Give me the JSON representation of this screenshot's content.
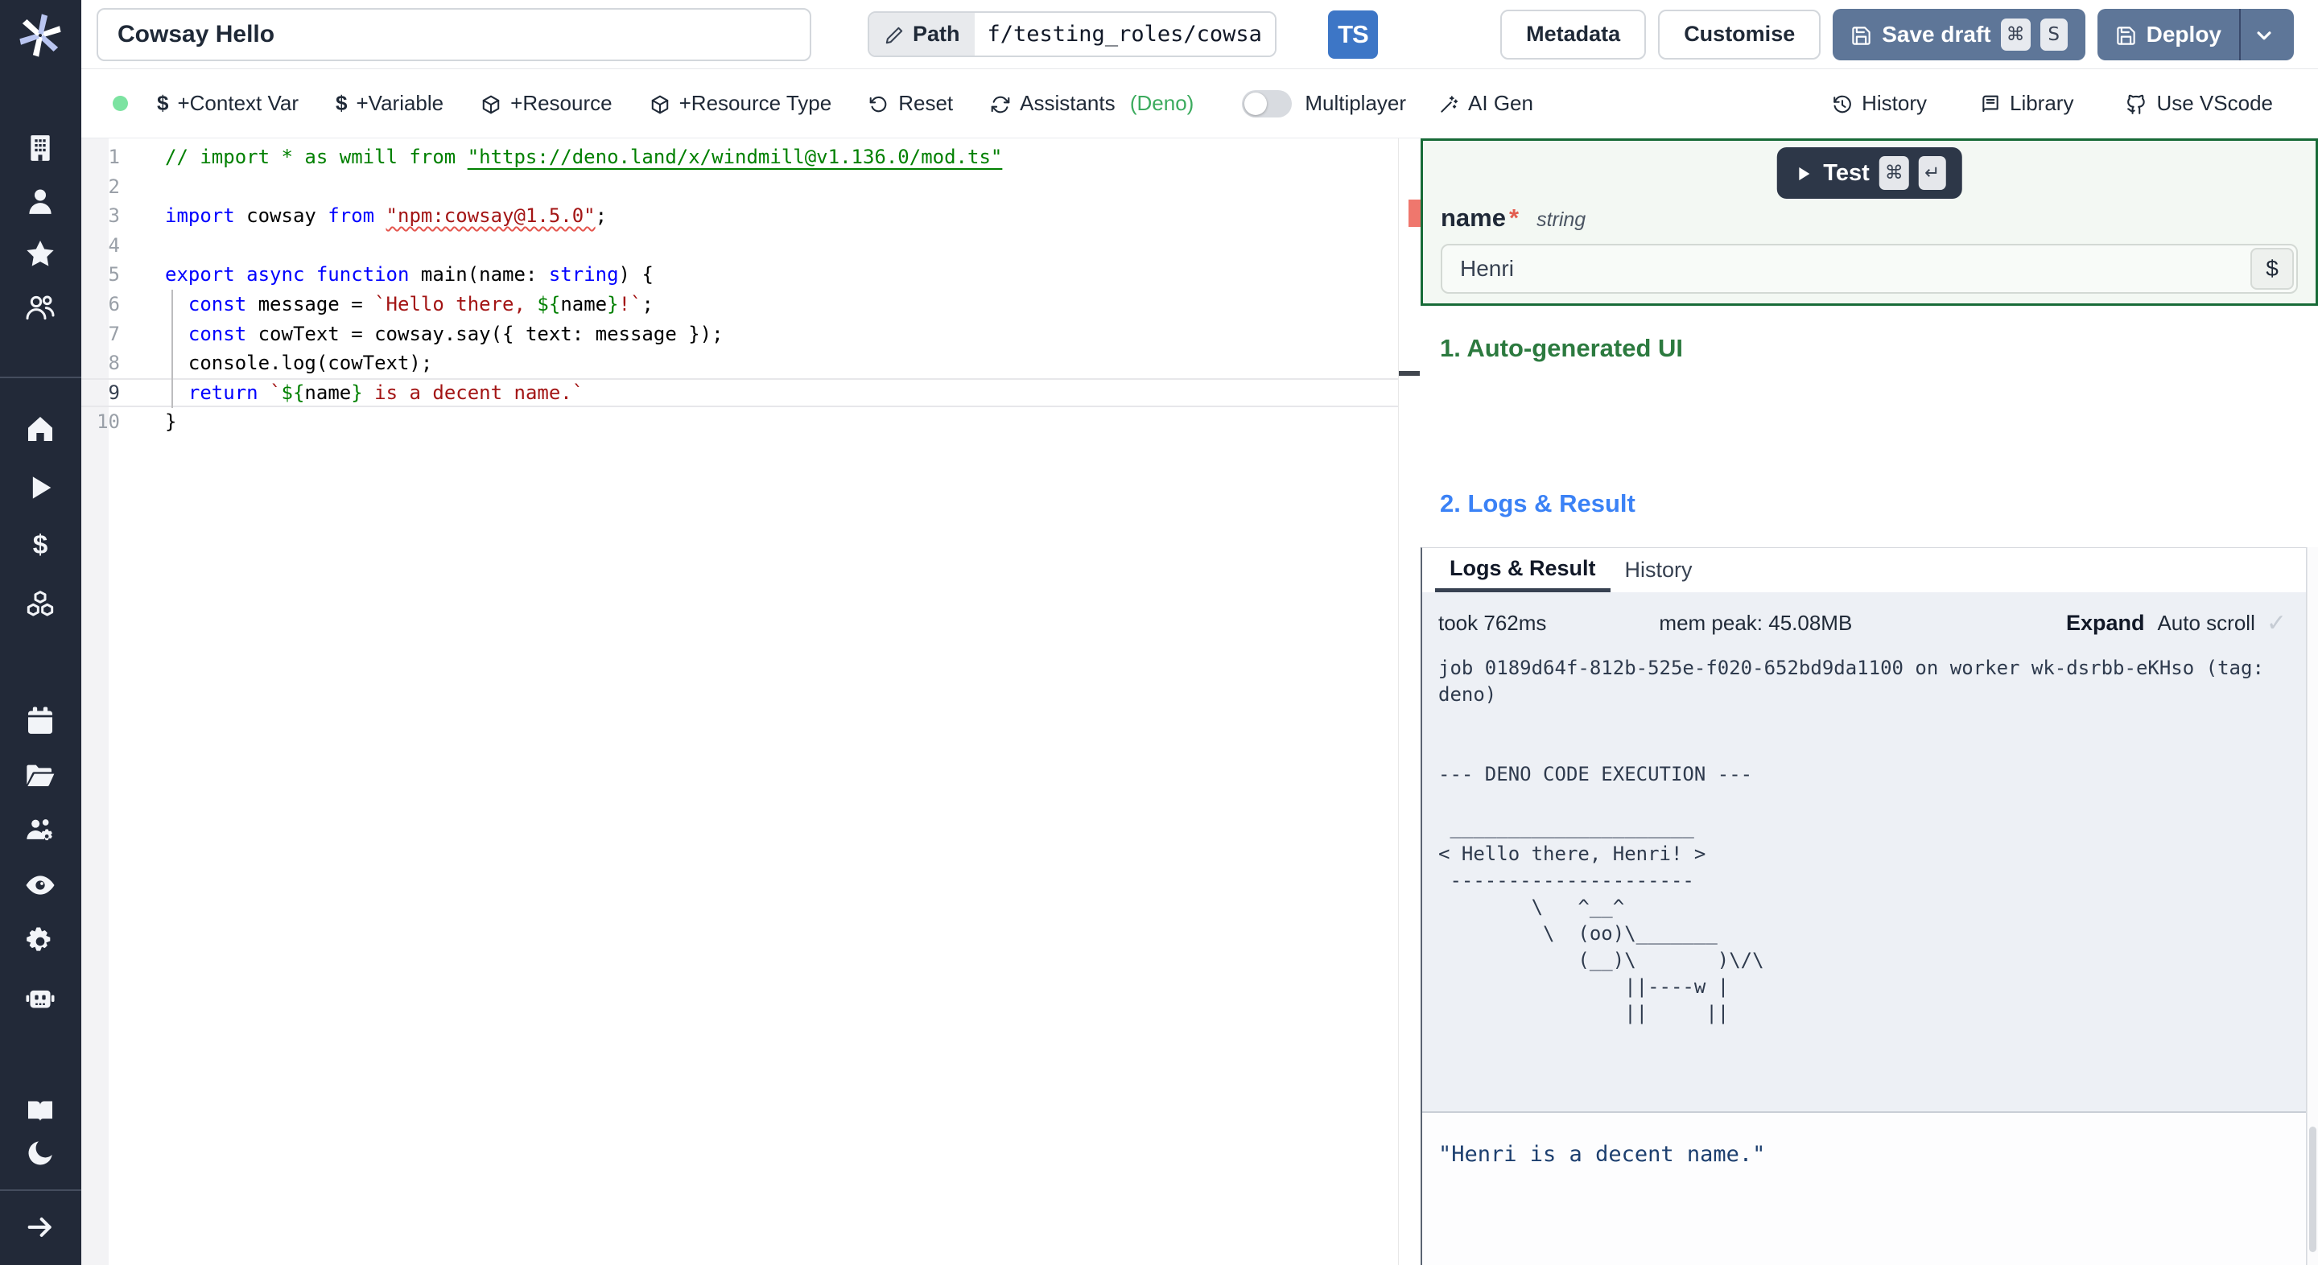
{
  "colors": {
    "sidebar": "#222938",
    "slate": "#5e7698",
    "ts": "#3d76c6",
    "deno": "#3cab5e",
    "green": "#2c7a3f",
    "greenb": "#176b37",
    "blue": "#3b82f6",
    "dark": "#2d3748",
    "err": "#ef776d"
  },
  "topbar": {
    "title_value": "Cowsay Hello",
    "path_label": "Path",
    "path_value": "f/testing_roles/cowsa",
    "lang_badge": "TS",
    "metadata_label": "Metadata",
    "customise_label": "Customise",
    "save_draft_label": "Save draft",
    "save_kbd": [
      "⌘",
      "S"
    ],
    "deploy_label": "Deploy"
  },
  "toolbar": {
    "left_items": [
      {
        "icon": "dollar",
        "label": "+Context Var"
      },
      {
        "icon": "dollar",
        "label": "+Variable"
      },
      {
        "icon": "package",
        "label": "+Resource"
      },
      {
        "icon": "package",
        "label": "+Resource Type"
      },
      {
        "icon": "reset",
        "label": "Reset"
      },
      {
        "icon": "refresh",
        "label": "Assistants",
        "accent": "(Deno)"
      }
    ],
    "multiplayer_label": "Multiplayer",
    "ai_gen_label": "AI Gen",
    "right_items": [
      {
        "icon": "history",
        "label": "History"
      },
      {
        "icon": "library",
        "label": "Library"
      },
      {
        "icon": "github",
        "label": "Use VScode"
      }
    ]
  },
  "sidebar": {
    "items": [
      "building",
      "user",
      "star",
      "users",
      "home",
      "play",
      "dollar",
      "cubes",
      "calendar",
      "folder",
      "user-gear",
      "eye",
      "gear",
      "robot",
      "book",
      "moon",
      "arrow-right"
    ]
  },
  "editor": {
    "lines": [
      {
        "n": "1",
        "seg": [
          {
            "c": "com",
            "t": "// import * as wmill from "
          },
          {
            "c": "com link",
            "t": "\"https://deno.land/x/windmill@v1.136.0/mod.ts\""
          }
        ]
      },
      {
        "n": "2",
        "seg": []
      },
      {
        "n": "3",
        "seg": [
          {
            "c": "key",
            "t": "import"
          },
          {
            "c": "pln",
            "t": " cowsay "
          },
          {
            "c": "key",
            "t": "from"
          },
          {
            "c": "pln",
            "t": " "
          },
          {
            "c": "str squiggle",
            "t": "\"npm:cowsay@1.5.0\""
          },
          {
            "c": "pln",
            "t": ";"
          }
        ]
      },
      {
        "n": "4",
        "seg": []
      },
      {
        "n": "5",
        "seg": [
          {
            "c": "key",
            "t": "export"
          },
          {
            "c": "pln",
            "t": " "
          },
          {
            "c": "key",
            "t": "async"
          },
          {
            "c": "pln",
            "t": " "
          },
          {
            "c": "key",
            "t": "function"
          },
          {
            "c": "pln",
            "t": " main(name: "
          },
          {
            "c": "key",
            "t": "string"
          },
          {
            "c": "pln",
            "t": ") {"
          }
        ]
      },
      {
        "n": "6",
        "seg": [
          {
            "c": "pln",
            "t": "  "
          },
          {
            "c": "key",
            "t": "const"
          },
          {
            "c": "pln",
            "t": " message = "
          },
          {
            "c": "str",
            "t": "`Hello there, "
          },
          {
            "c": "tpl",
            "t": "${"
          },
          {
            "c": "pln",
            "t": "name"
          },
          {
            "c": "tpl",
            "t": "}"
          },
          {
            "c": "str",
            "t": "!`"
          },
          {
            "c": "pln",
            "t": ";"
          }
        ]
      },
      {
        "n": "7",
        "seg": [
          {
            "c": "pln",
            "t": "  "
          },
          {
            "c": "key",
            "t": "const"
          },
          {
            "c": "pln",
            "t": " cowText = cowsay.say({ text: message });"
          }
        ]
      },
      {
        "n": "8",
        "seg": [
          {
            "c": "pln",
            "t": "  console.log(cowText);"
          }
        ]
      },
      {
        "n": "9",
        "current": true,
        "seg": [
          {
            "c": "pln",
            "t": "  "
          },
          {
            "c": "key",
            "t": "return"
          },
          {
            "c": "pln",
            "t": " "
          },
          {
            "c": "str",
            "t": "`"
          },
          {
            "c": "tpl",
            "t": "${"
          },
          {
            "c": "pln",
            "t": "name"
          },
          {
            "c": "tpl",
            "t": "}"
          },
          {
            "c": "str",
            "t": " is a decent name.`"
          }
        ]
      },
      {
        "n": "10",
        "seg": [
          {
            "c": "pln",
            "t": "}"
          }
        ]
      }
    ]
  },
  "runner": {
    "test_label": "Test",
    "test_kbd": [
      "⌘",
      "↵"
    ],
    "field_name": "name",
    "field_required": "*",
    "field_type": "string",
    "field_value": "Henri",
    "field_suffix": "$"
  },
  "sections": {
    "one": "1. Auto-generated UI",
    "two": "2. Logs & Result"
  },
  "results": {
    "tabs": [
      "Logs & Result",
      "History"
    ],
    "active_tab": "Logs & Result",
    "took": "took 762ms",
    "mem": "mem peak: 45.08MB",
    "expand_label": "Expand",
    "autoscroll_label": "Auto scroll",
    "autoscroll_checked": "✓",
    "log_lines": [
      "job 0189d64f-812b-525e-f020-652bd9da1100 on worker wk-dsrbb-eKHso (tag:",
      "deno)",
      "",
      "",
      "--- DENO CODE EXECUTION ---",
      "",
      " _____________________",
      "< Hello there, Henri! >",
      " ---------------------",
      "        \\   ^__^",
      "         \\  (oo)\\_______",
      "            (__)\\       )\\/\\",
      "                ||----w |",
      "                ||     ||"
    ],
    "result_value": "\"Henri is a decent name.\""
  }
}
